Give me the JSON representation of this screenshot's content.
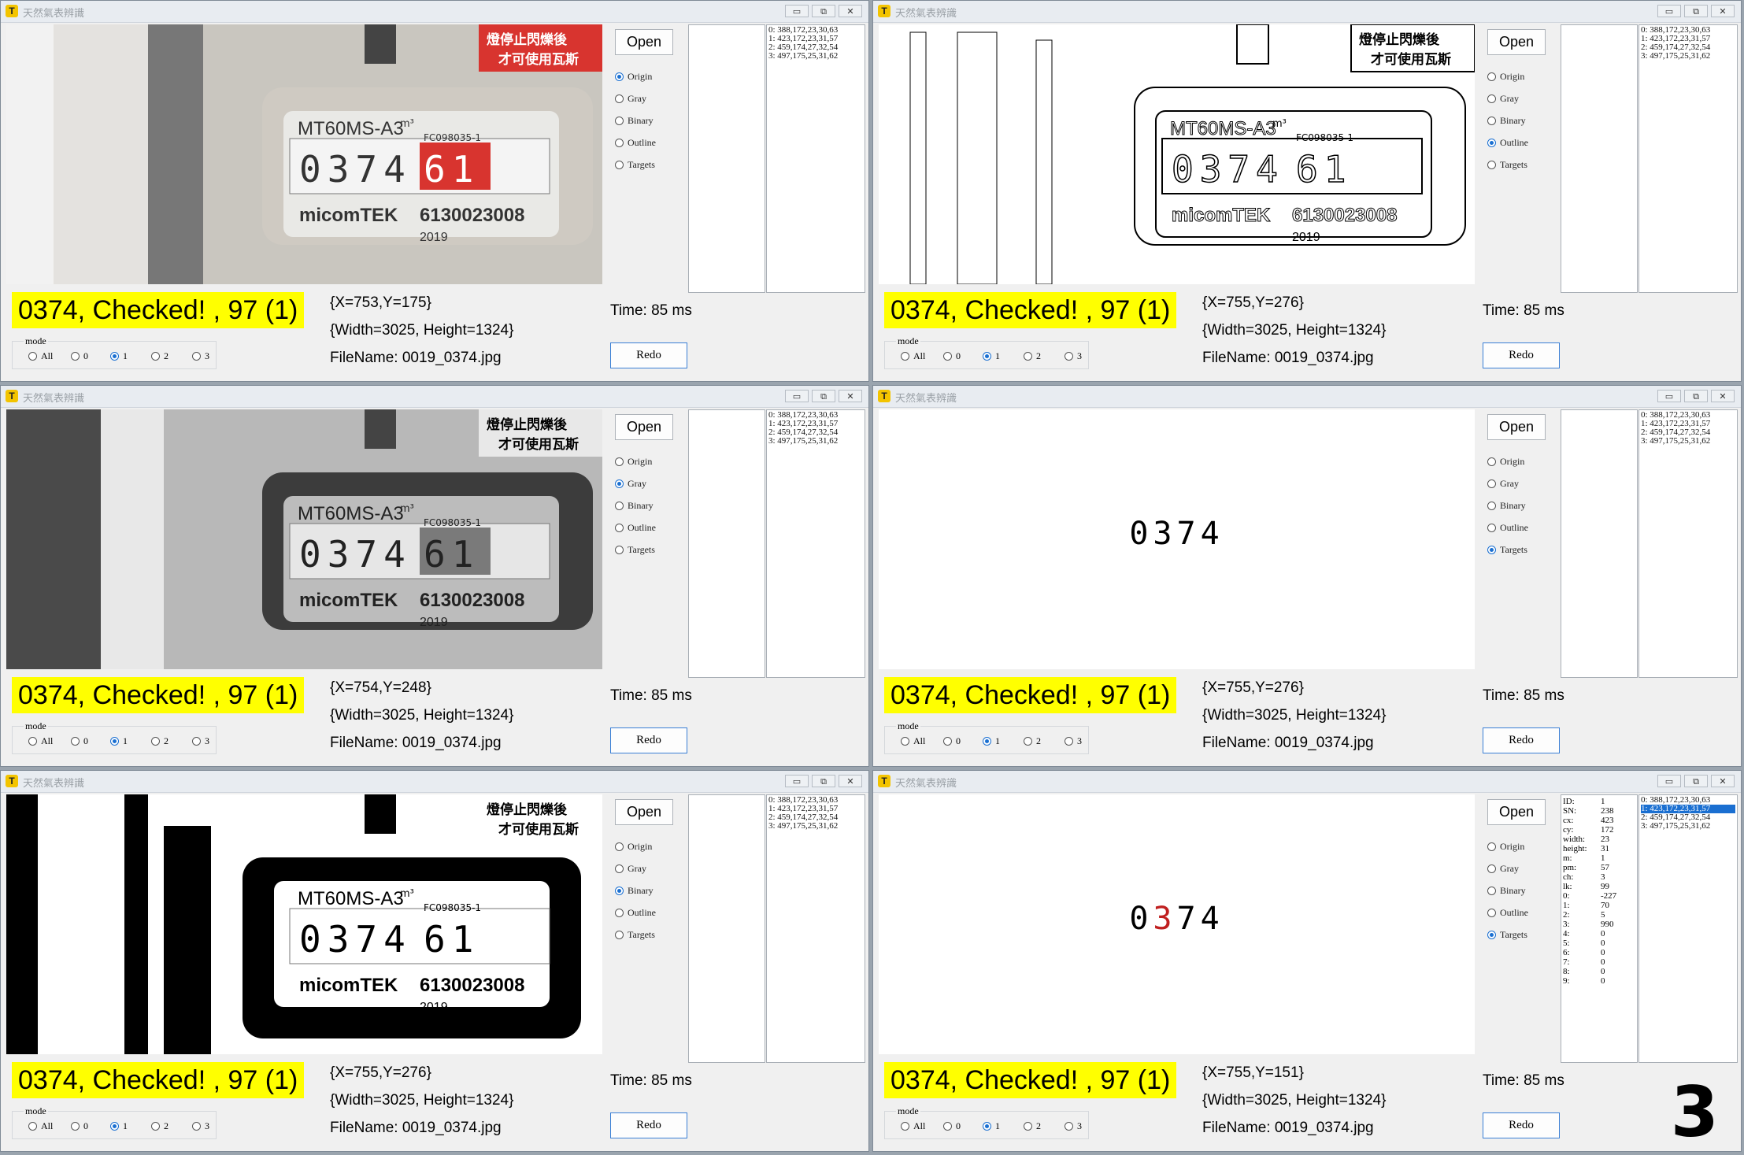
{
  "app": {
    "title": "天然氣表辨識",
    "logo": "T",
    "min": "▭",
    "max": "⧉",
    "close": "✕"
  },
  "common": {
    "open_label": "Open",
    "redo_label": "Redo",
    "time": "Time: 85 ms",
    "size": "{Width=3025, Height=1324}",
    "filename": "FileName: 0019_0374.jpg",
    "result": "0374, Checked! , 97 (1)",
    "radio_labels": [
      "Origin",
      "Gray",
      "Binary",
      "Outline",
      "Targets"
    ],
    "mode_title": "mode",
    "mode_options": [
      "All",
      "0",
      "1",
      "2",
      "3"
    ],
    "mode_selected": 2,
    "targets_list": [
      "0: 388,172,23,30,63",
      "1: 423,172,23,31,57",
      "2: 459,174,27,32,54",
      "3: 497,175,25,31,62"
    ]
  },
  "meter": {
    "model": "MT60MS-A3",
    "unit": "m³",
    "digits": "0374",
    "red_digits": "61",
    "brand": "micomTEK",
    "serial": "6130023008",
    "year": "2019",
    "cert": "FC098035-1",
    "warning": "燈停止閃爍後 才可使用瓦斯"
  },
  "windows": [
    {
      "view": "Origin",
      "radio": 0,
      "xy": "{X=753,Y=175}"
    },
    {
      "view": "Outline",
      "radio": 3,
      "xy": "{X=755,Y=276}"
    },
    {
      "view": "Gray",
      "radio": 1,
      "xy": "{X=754,Y=248}"
    },
    {
      "view": "Targets",
      "radio": 4,
      "xy": "{X=755,Y=276}",
      "targets_text": "0374"
    },
    {
      "view": "Binary",
      "radio": 2,
      "xy": "{X=755,Y=276}"
    },
    {
      "view": "Targets",
      "radio": 4,
      "xy": "{X=755,Y=151}",
      "targets_text": "0374",
      "highlight_index": 1,
      "selected_line": 1,
      "big_digit": "3",
      "details": [
        [
          "ID:",
          "1"
        ],
        [
          "SN:",
          "238"
        ],
        [
          "cx:",
          "423"
        ],
        [
          "cy:",
          "172"
        ],
        [
          "width:",
          "23"
        ],
        [
          "height:",
          "31"
        ],
        [
          "m:",
          "1"
        ],
        [
          "pm:",
          "57"
        ],
        [
          "ch:",
          "3"
        ],
        [
          "lk:",
          "99"
        ],
        [
          "0:",
          "-227"
        ],
        [
          "1:",
          "70"
        ],
        [
          "2:",
          "5"
        ],
        [
          "3:",
          "990"
        ],
        [
          "4:",
          "0"
        ],
        [
          "5:",
          "0"
        ],
        [
          "6:",
          "0"
        ],
        [
          "7:",
          "0"
        ],
        [
          "8:",
          "0"
        ],
        [
          "9:",
          "0"
        ]
      ]
    }
  ]
}
